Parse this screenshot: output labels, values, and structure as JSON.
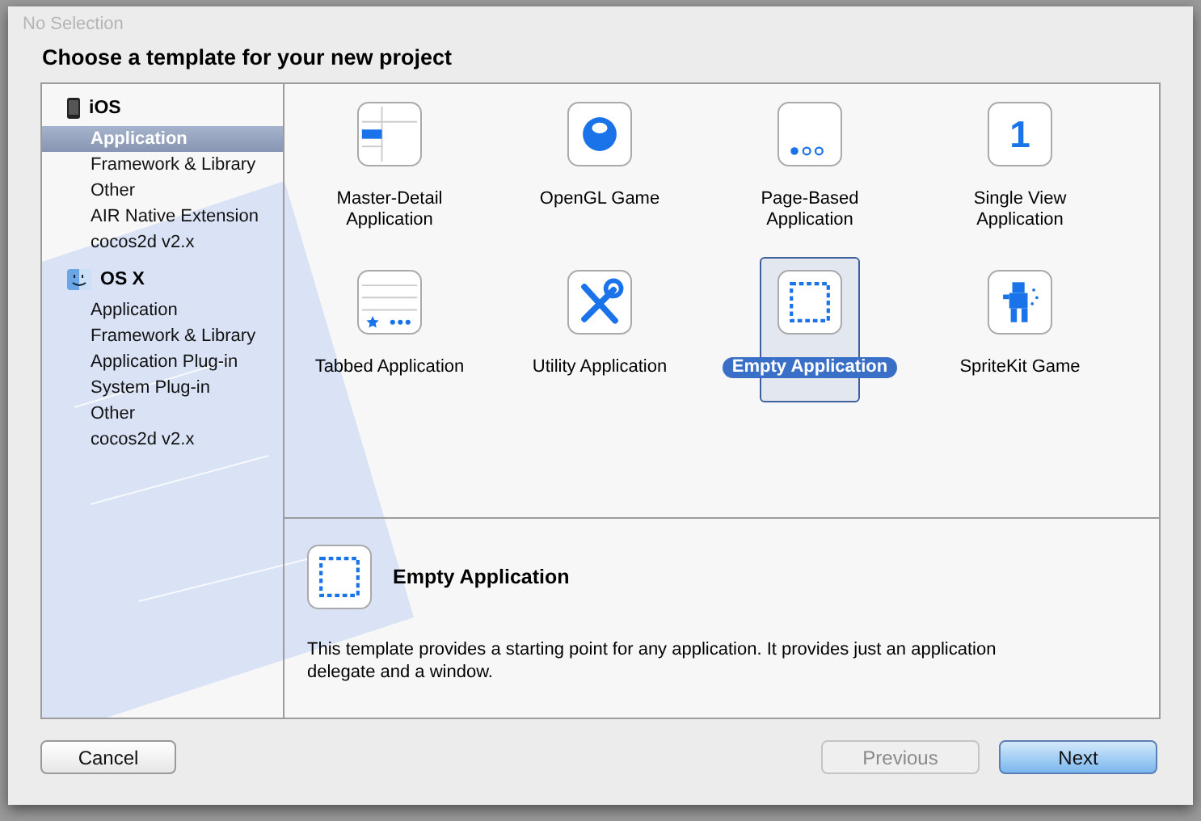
{
  "background_title": "No Selection",
  "dialog": {
    "title": "Choose a template for your new project"
  },
  "sidebar": {
    "groups": [
      {
        "label": "iOS",
        "kind": "device",
        "items": [
          {
            "label": "Application",
            "selected": true
          },
          {
            "label": "Framework & Library",
            "selected": false
          },
          {
            "label": "Other",
            "selected": false
          },
          {
            "label": "AIR Native Extension",
            "selected": false
          },
          {
            "label": "cocos2d v2.x",
            "selected": false
          }
        ]
      },
      {
        "label": "OS X",
        "kind": "desktop",
        "items": [
          {
            "label": "Application",
            "selected": false
          },
          {
            "label": "Framework & Library",
            "selected": false
          },
          {
            "label": "Application Plug-in",
            "selected": false
          },
          {
            "label": "System Plug-in",
            "selected": false
          },
          {
            "label": "Other",
            "selected": false
          },
          {
            "label": "cocos2d v2.x",
            "selected": false
          }
        ]
      }
    ]
  },
  "templates": [
    {
      "label": "Master-Detail Application",
      "kind": "master-detail",
      "selected": false
    },
    {
      "label": "OpenGL Game",
      "kind": "opengl",
      "selected": false
    },
    {
      "label": "Page-Based Application",
      "kind": "page-based",
      "selected": false
    },
    {
      "label": "Single View Application",
      "kind": "single-view",
      "glyph": "1",
      "selected": false
    },
    {
      "label": "Tabbed Application",
      "kind": "tabbed",
      "selected": false
    },
    {
      "label": "Utility Application",
      "kind": "utility",
      "selected": false
    },
    {
      "label": "Empty Application",
      "kind": "empty",
      "selected": true
    },
    {
      "label": "SpriteKit Game",
      "kind": "spritekit",
      "selected": false
    }
  ],
  "detail": {
    "title": "Empty Application",
    "kind": "empty",
    "description": "This template provides a starting point for any application. It provides just an application delegate and a window."
  },
  "buttons": [
    {
      "label": "Cancel",
      "kind": "normal",
      "disabled": false
    },
    {
      "label": "Previous",
      "kind": "normal",
      "disabled": true
    },
    {
      "label": "Next",
      "kind": "default",
      "disabled": false
    }
  ]
}
